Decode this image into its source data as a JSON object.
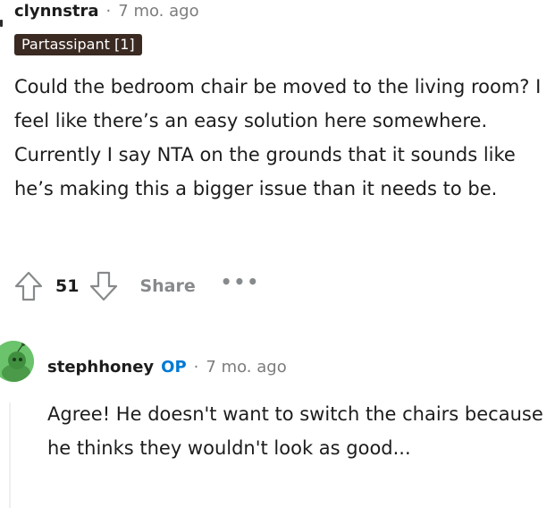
{
  "comment": {
    "username": "clynnstra",
    "separator": "·",
    "timestamp": "7 mo. ago",
    "flair": "Partassipant [1]",
    "body": "Could the bedroom chair be moved to the living room? I feel like there’s an easy solution here somewhere. Currently I say NTA on the grounds that it sounds like he’s making this a bigger issue than it needs to be.",
    "actions": {
      "upvote_icon": "upvote-arrow-icon",
      "vote_count": "51",
      "downvote_icon": "downvote-arrow-icon",
      "share_label": "Share",
      "more_label": "•••"
    }
  },
  "reply": {
    "avatar_icon": "snoo-avatar-icon",
    "username": "stephhoney",
    "op_label": "OP",
    "separator": "·",
    "timestamp": "7 mo. ago",
    "body": "Agree! He doesn't want to switch the chairs because he thinks they wouldn't look as good..."
  },
  "colors": {
    "flair_bg": "#3a2a22",
    "op_blue": "#0079d3",
    "muted_gray": "#878a8c",
    "avatar_green": "#6bc36b"
  }
}
